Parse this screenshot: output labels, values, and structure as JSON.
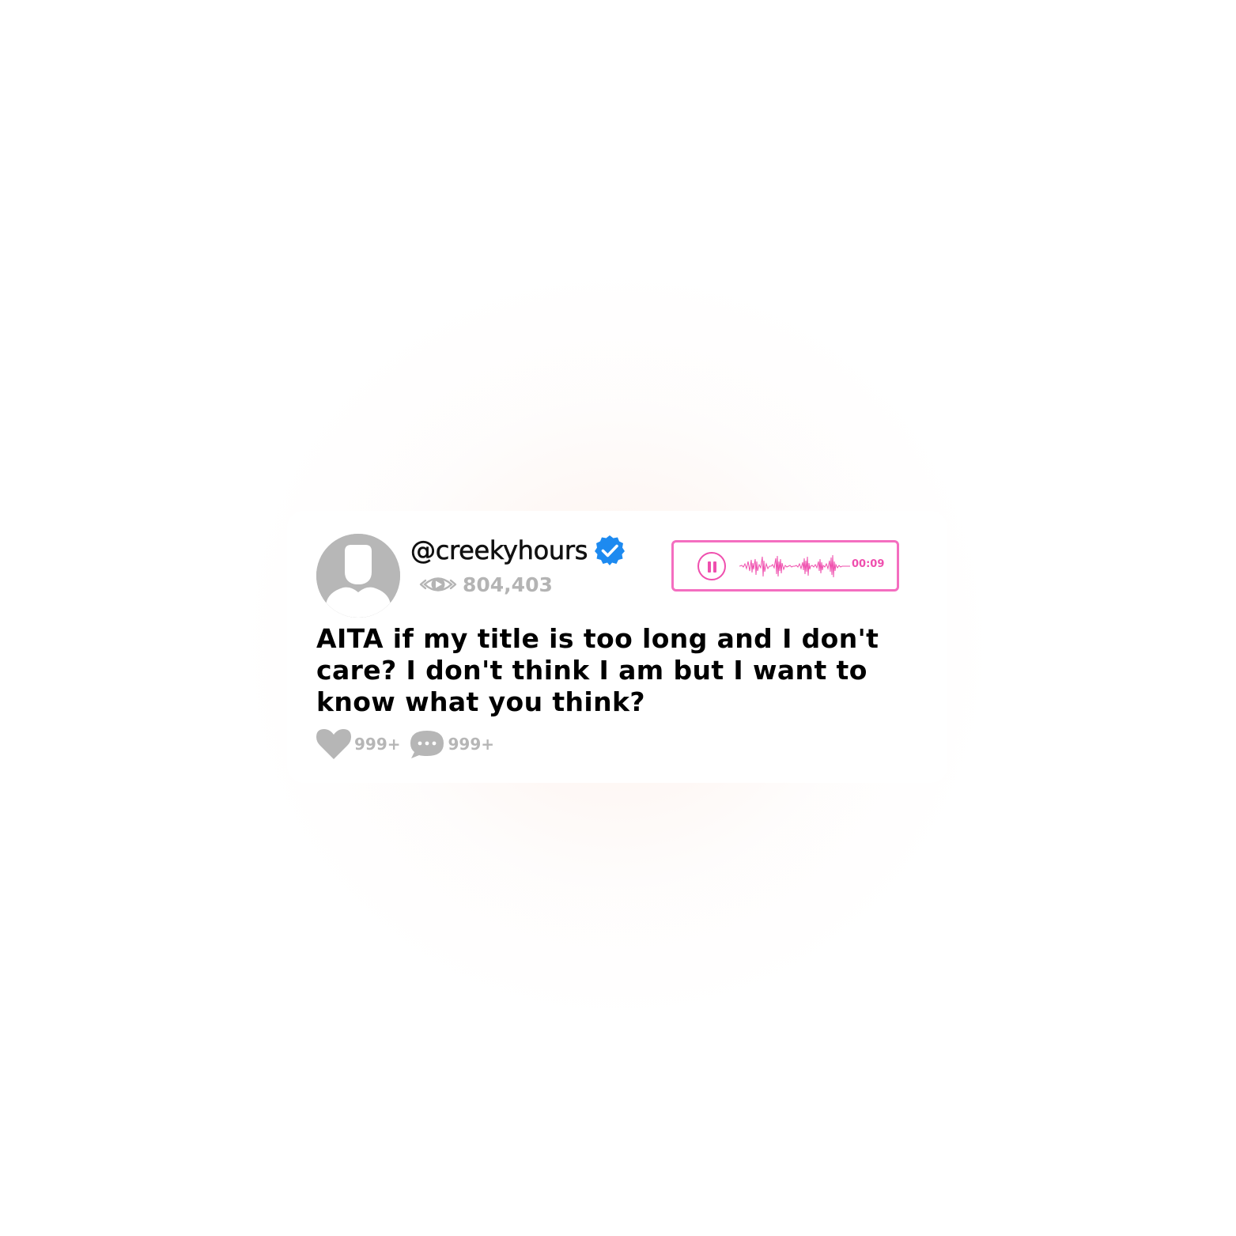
{
  "post": {
    "username": "@creekyhours",
    "verified": true,
    "views": "804,403",
    "title": "AITA if my title is too long and I don't care? I don't think I am but I want to know what you think?",
    "likes": "999+",
    "comments": "999+"
  },
  "audio_player": {
    "state": "playing",
    "time": "00:09"
  },
  "icons": {
    "avatar": "default-user-icon",
    "verified": "verified-badge-icon",
    "views": "eye-icon",
    "pause": "pause-icon",
    "like": "heart-icon",
    "comment": "comment-bubble-icon"
  },
  "colors": {
    "accent": "#ef4fae",
    "player_border": "#f46ec0",
    "verified_blue": "#1d8af0",
    "muted_gray": "#b4b4b4",
    "avatar_gray": "#b7b7b7"
  }
}
